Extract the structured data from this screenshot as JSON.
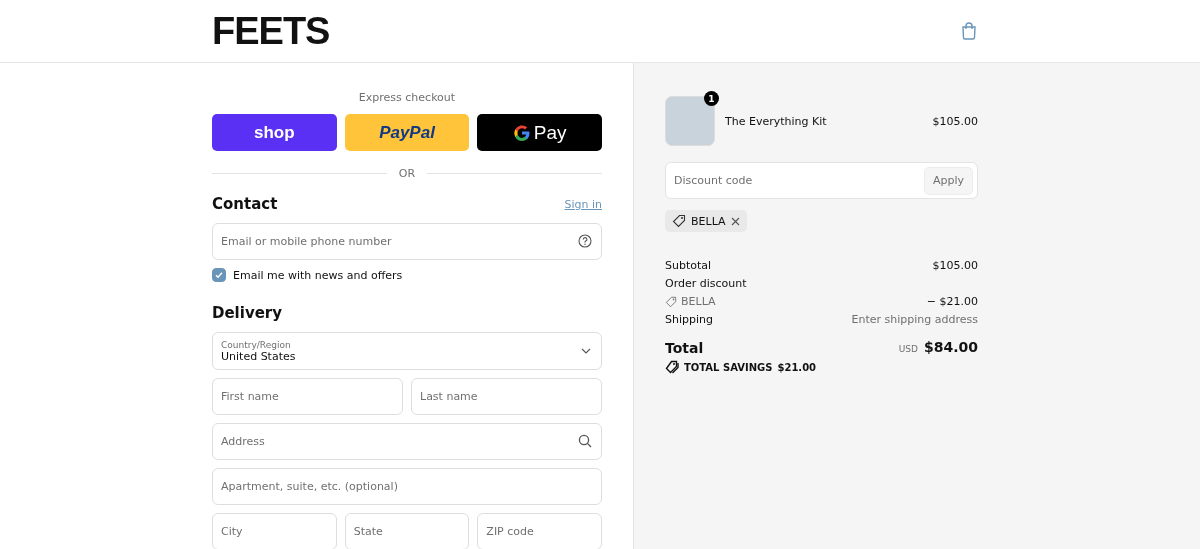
{
  "header": {
    "logo": "FEETS"
  },
  "express": {
    "title": "Express checkout",
    "buttons": [
      {
        "kind": "shop",
        "label": "shop"
      },
      {
        "kind": "paypal",
        "label": "PayPal"
      },
      {
        "kind": "gpay",
        "label": "Pay"
      }
    ],
    "divider": "OR"
  },
  "contact": {
    "title": "Contact",
    "sign_in": "Sign in",
    "email": {
      "placeholder": "Email or mobile phone number"
    },
    "newsletter": {
      "label": "Email me with news and offers",
      "checked": true
    }
  },
  "delivery": {
    "title": "Delivery",
    "country": {
      "label": "Country/Region",
      "value": "United States"
    },
    "fields": [
      [
        {
          "placeholder": "First name"
        },
        {
          "placeholder": "Last name"
        }
      ],
      [
        {
          "placeholder": "Address",
          "search": true
        }
      ],
      [
        {
          "placeholder": "Apartment, suite, etc. (optional)"
        }
      ],
      [
        {
          "placeholder": "City"
        },
        {
          "placeholder": "State"
        },
        {
          "placeholder": "ZIP code"
        }
      ]
    ]
  },
  "summary": {
    "items": [
      {
        "name": "The Everything Kit",
        "quantity": "1",
        "price": "$105.00"
      }
    ],
    "discount": {
      "placeholder": "Discount code",
      "button": "Apply"
    },
    "applied_codes": [
      {
        "code": "BELLA"
      }
    ],
    "subtotal": {
      "label": "Subtotal",
      "value": "$105.00"
    },
    "order_discount": {
      "label": "Order discount",
      "code": "BELLA",
      "value": "− $21.00"
    },
    "shipping": {
      "label": "Shipping",
      "value": "Enter shipping address"
    },
    "total": {
      "label": "Total",
      "currency": "USD",
      "value": "$84.00"
    },
    "savings": {
      "label": "TOTAL SAVINGS",
      "value": "$21.00"
    }
  }
}
